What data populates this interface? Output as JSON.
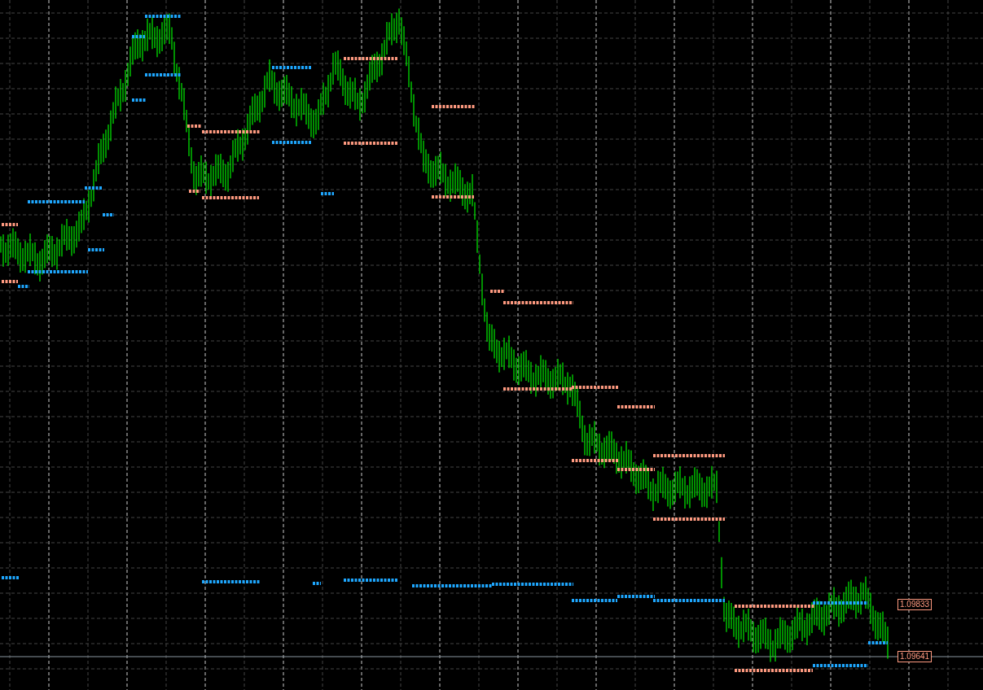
{
  "price_labels": [
    {
      "value": "1.09833"
    },
    {
      "value": "1.09641"
    }
  ]
}
